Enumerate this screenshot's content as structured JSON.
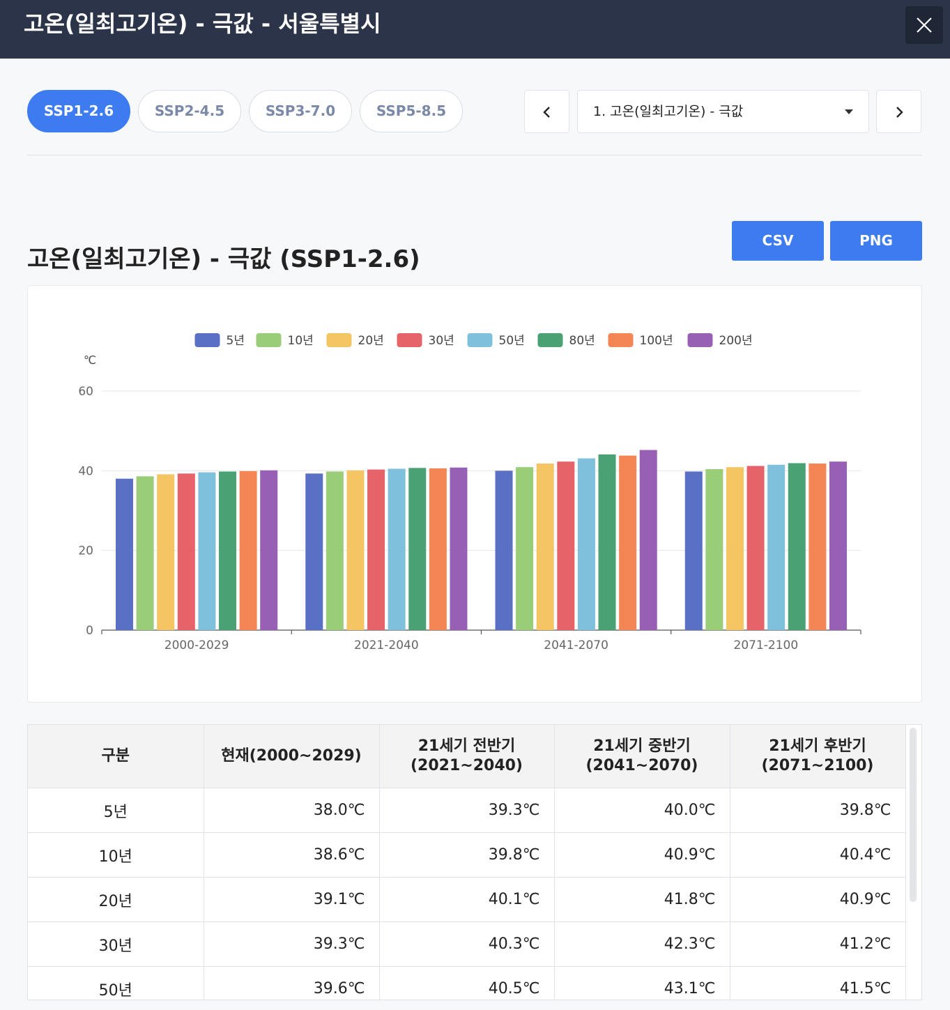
{
  "header": {
    "title": "고온(일최고기온) - 극값 - 서울특별시"
  },
  "scenarios": {
    "items": [
      {
        "label": "SSP1-2.6",
        "active": true
      },
      {
        "label": "SSP2-4.5",
        "active": false
      },
      {
        "label": "SSP3-7.0",
        "active": false
      },
      {
        "label": "SSP5-8.5",
        "active": false
      }
    ]
  },
  "indicator_select": {
    "value": "1. 고온(일최고기온) - 극값"
  },
  "chart_section": {
    "title": "고온(일최고기온) - 극값 (SSP1-2.6)",
    "csv_label": "CSV",
    "png_label": "PNG"
  },
  "chart_data": {
    "type": "bar",
    "ylabel": "℃",
    "ylim": [
      0,
      60
    ],
    "yticks": [
      0,
      20,
      40,
      60
    ],
    "grid": true,
    "legend_position": "top",
    "categories": [
      "2000-2029",
      "2021-2040",
      "2041-2070",
      "2071-2100"
    ],
    "series": [
      {
        "name": "5년",
        "color": "#5a70c4",
        "values": [
          38.0,
          39.3,
          40.0,
          39.8
        ]
      },
      {
        "name": "10년",
        "color": "#99cd78",
        "values": [
          38.6,
          39.8,
          40.9,
          40.4
        ]
      },
      {
        "name": "20년",
        "color": "#f5c463",
        "values": [
          39.1,
          40.1,
          41.8,
          40.9
        ]
      },
      {
        "name": "30년",
        "color": "#e6636a",
        "values": [
          39.3,
          40.3,
          42.3,
          41.2
        ]
      },
      {
        "name": "50년",
        "color": "#7fc0dd",
        "values": [
          39.6,
          40.5,
          43.1,
          41.5
        ]
      },
      {
        "name": "80년",
        "color": "#4aa274",
        "values": [
          39.8,
          40.7,
          44.1,
          41.9
        ]
      },
      {
        "name": "100년",
        "color": "#f48555",
        "values": [
          39.9,
          40.6,
          43.8,
          41.8
        ]
      },
      {
        "name": "200년",
        "color": "#9860b4",
        "values": [
          40.1,
          40.8,
          45.2,
          42.3
        ]
      }
    ]
  },
  "table": {
    "headers": [
      "구분",
      "현재(2000~2029)",
      "21세기 전반기\n(2021~2040)",
      "21세기 중반기\n(2041~2070)",
      "21세기 후반기\n(2071~2100)"
    ],
    "rows": [
      [
        "5년",
        "38.0℃",
        "39.3℃",
        "40.0℃",
        "39.8℃"
      ],
      [
        "10년",
        "38.6℃",
        "39.8℃",
        "40.9℃",
        "40.4℃"
      ],
      [
        "20년",
        "39.1℃",
        "40.1℃",
        "41.8℃",
        "40.9℃"
      ],
      [
        "30년",
        "39.3℃",
        "40.3℃",
        "42.3℃",
        "41.2℃"
      ],
      [
        "50년",
        "39.6℃",
        "40.5℃",
        "43.1℃",
        "41.5℃"
      ]
    ]
  },
  "colors": {
    "header_bg": "#2c344a",
    "accent": "#3d7cf0"
  }
}
